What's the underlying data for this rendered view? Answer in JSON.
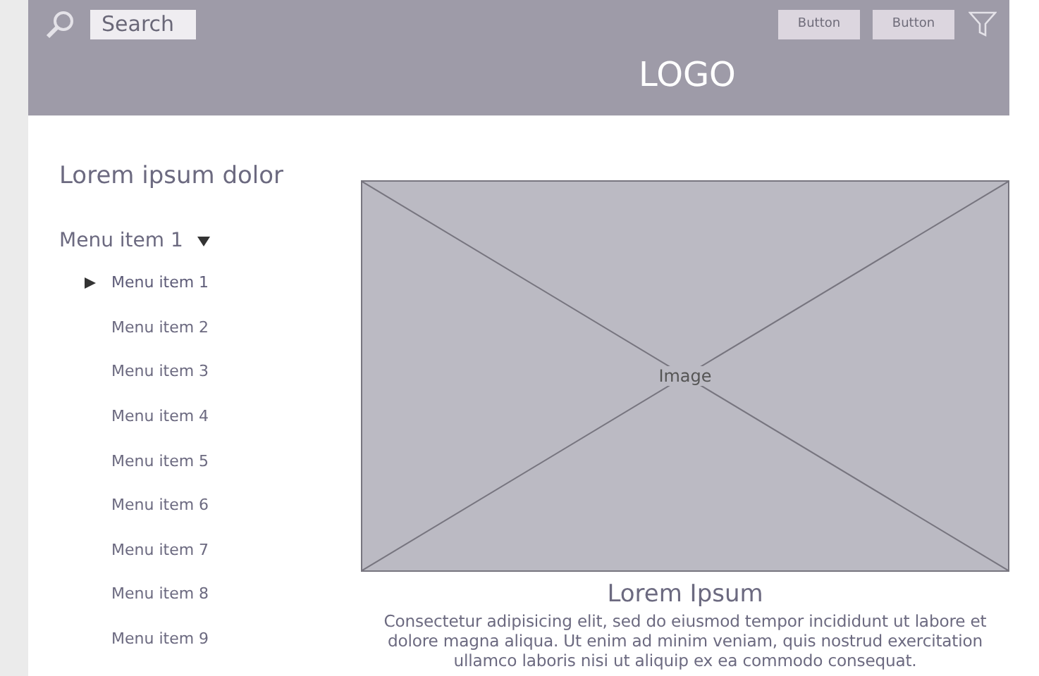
{
  "header": {
    "search": {
      "placeholder": "Search"
    },
    "buttons": [
      "Button",
      "Button"
    ],
    "logo": "LOGO"
  },
  "sidebar": {
    "title": "Lorem ipsum dolor",
    "menu": [
      {
        "label": "Menu item 1",
        "expanded": true,
        "children": [
          {
            "label": "Menu item 1",
            "selected": true
          },
          {
            "label": "Menu item 2",
            "selected": false
          },
          {
            "label": "Menu item 3",
            "selected": false
          },
          {
            "label": "Menu item 4",
            "selected": false
          },
          {
            "label": "Menu item 5",
            "selected": false
          },
          {
            "label": "Menu item 6",
            "selected": false
          },
          {
            "label": "Menu item 7",
            "selected": false
          },
          {
            "label": "Menu item 8",
            "selected": false
          },
          {
            "label": "Menu item 9",
            "selected": false
          }
        ]
      }
    ]
  },
  "content": {
    "image_label": "Image",
    "title": "Lorem Ipsum",
    "text": "Consectetur adipisicing elit, sed do eiusmod tempor incididunt ut labore et dolore magna aliqua. Ut enim ad minim veniam, quis nostrud exercitation ullamco laboris nisi ut aliquip ex ea commodo consequat."
  }
}
